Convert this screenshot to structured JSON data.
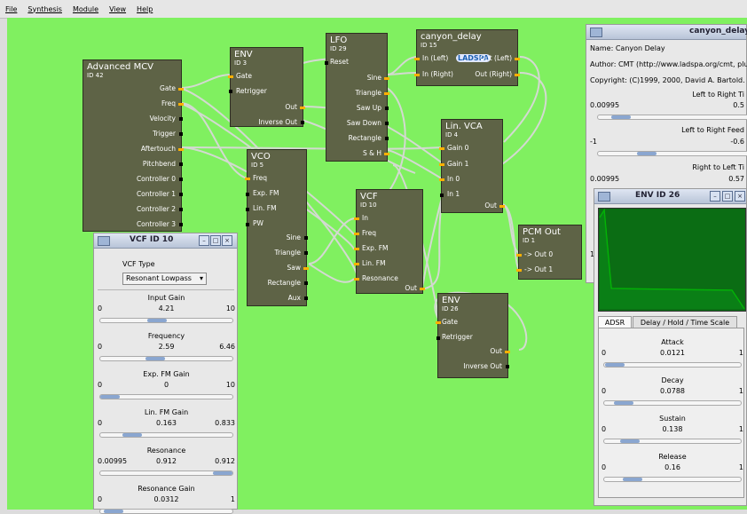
{
  "menu": [
    "File",
    "Synthesis",
    "Module",
    "View",
    "Help"
  ],
  "modules": {
    "mcv": {
      "title": "Advanced MCV",
      "id": "ID 42",
      "outputs": [
        "Gate",
        "Freq",
        "Velocity",
        "Trigger",
        "Aftertouch",
        "Pitchbend",
        "Controller 0",
        "Controller 1",
        "Controller 2",
        "Controller 3"
      ]
    },
    "env3": {
      "title": "ENV",
      "id": "ID 3",
      "inputs": [
        "Gate",
        "Retrigger"
      ],
      "outputs": [
        "Out",
        "Inverse Out"
      ]
    },
    "lfo": {
      "title": "LFO",
      "id": "ID 29",
      "inputs": [
        "Reset"
      ],
      "outputs": [
        "Sine",
        "Triangle",
        "Saw Up",
        "Saw Down",
        "Rectangle",
        "S & H"
      ]
    },
    "canyon": {
      "title": "canyon_delay",
      "id": "ID 15",
      "logo": "LADSPA",
      "inputs": [
        "In (Left)",
        "In (Right)"
      ],
      "outputs": [
        "Out (Left)",
        "Out (Right)"
      ]
    },
    "vco": {
      "title": "VCO",
      "id": "ID 5",
      "inputs": [
        "Freq",
        "Exp. FM",
        "Lin. FM",
        "PW"
      ],
      "outputs": [
        "Sine",
        "Triangle",
        "Saw",
        "Rectangle",
        "Aux"
      ]
    },
    "vca": {
      "title": "Lin. VCA",
      "id": "ID 4",
      "inputs": [
        "Gain 0",
        "Gain 1",
        "In 0",
        "In 1"
      ],
      "outputs": [
        "Out"
      ]
    },
    "vcf": {
      "title": "VCF",
      "id": "ID 10",
      "inputs": [
        "In",
        "Freq",
        "Exp. FM",
        "Lin. FM",
        "Resonance"
      ],
      "outputs": [
        "Out"
      ]
    },
    "pcm": {
      "title": "PCM Out",
      "id": "ID 1",
      "inputs": [
        "-> Out  0",
        "-> Out  1"
      ]
    },
    "env26": {
      "title": "ENV",
      "id": "ID 26",
      "inputs": [
        "Gate",
        "Retrigger"
      ],
      "outputs": [
        "Out",
        "Inverse Out"
      ]
    }
  },
  "canyon_panel": {
    "title": "canyon_delay",
    "name": "Name: Canyon Delay",
    "author": "Author: CMT (http://www.ladspa.org/cmt, plug",
    "copyright": "Copyright: (C)1999, 2000, David A. Bartold. GN",
    "params": [
      {
        "label": "Left to Right Ti",
        "min": "0.00995",
        "value": "",
        "max": "0.5",
        "fill": 0.1
      },
      {
        "label": "Left to Right Feed",
        "min": "-1",
        "value": "",
        "max": "-0.6",
        "fill": 0.3
      },
      {
        "label": "Right to Left Ti",
        "min": "0.00995",
        "value": "",
        "max": "0.57",
        "fill": 0.1
      }
    ]
  },
  "vcf_panel": {
    "title": "VCF ID 10",
    "type_label": "VCF Type",
    "type_value": "Resonant Lowpass",
    "params": [
      {
        "label": "Input Gain",
        "min": "0",
        "value": "4.21",
        "max": "10",
        "fill": 0.42
      },
      {
        "label": "Frequency",
        "min": "0",
        "value": "2.59",
        "max": "6.46",
        "fill": 0.4
      },
      {
        "label": "Exp. FM Gain",
        "min": "0",
        "value": "0",
        "max": "10",
        "fill": 0.0
      },
      {
        "label": "Lin. FM Gain",
        "min": "0",
        "value": "0.163",
        "max": "0.833",
        "fill": 0.2
      },
      {
        "label": "Resonance",
        "min": "0.00995",
        "value": "0.912",
        "max": "0.912",
        "fill": 1.0
      },
      {
        "label": "Resonance Gain",
        "min": "0",
        "value": "0.0312",
        "max": "1",
        "fill": 0.03
      }
    ]
  },
  "env_panel": {
    "title": "ENV ID 26",
    "tabs": [
      "ADSR",
      "Delay / Hold / Time Scale"
    ],
    "params": [
      {
        "label": "Attack",
        "min": "0",
        "value": "0.0121",
        "max": "1",
        "fill": 0.01
      },
      {
        "label": "Decay",
        "min": "0",
        "value": "0.0788",
        "max": "1",
        "fill": 0.08
      },
      {
        "label": "Sustain",
        "min": "0",
        "value": "0.138",
        "max": "1",
        "fill": 0.14
      },
      {
        "label": "Release",
        "min": "0",
        "value": "0.16",
        "max": "1",
        "fill": 0.16
      }
    ]
  },
  "partial_text": {
    "pcm_side": "1"
  },
  "colors": {
    "canvas": "#80f060",
    "module": "#5e6346",
    "port_active": "#ffb000",
    "scope_bg": "#0b6d14",
    "scope_line": "#00c000"
  }
}
